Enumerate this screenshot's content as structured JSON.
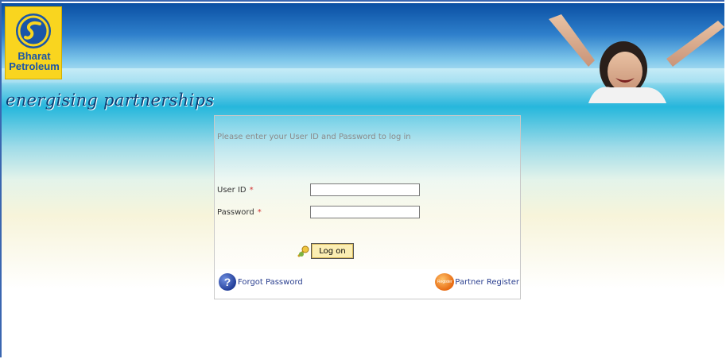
{
  "brand": {
    "logo_line1": "Bharat",
    "logo_line2": "Petroleum",
    "tagline": "energising partnerships",
    "colors": {
      "blue": "#1a55a8",
      "yellow": "#f9d51f"
    }
  },
  "login": {
    "instruction": "Please enter your User ID and Password to log in",
    "user_id_label": "User ID",
    "password_label": "Password",
    "required_mark": "*",
    "user_id_value": "",
    "password_value": "",
    "logon_label": "Log on"
  },
  "links": {
    "forgot_password": "Forgot Password",
    "partner_register": "Partner Register",
    "forgot_icon": "help-icon",
    "register_icon_text": "Register"
  }
}
